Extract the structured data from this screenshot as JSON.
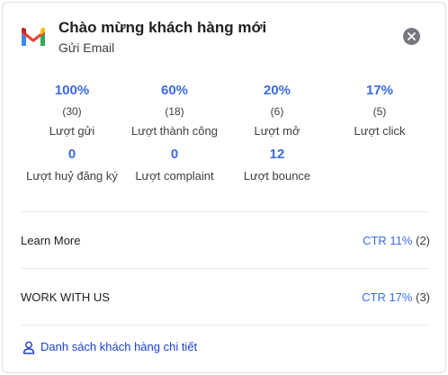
{
  "header": {
    "title": "Chào mừng khách hàng mới",
    "subtitle": "Gửi Email",
    "icon": "gmail-icon",
    "close_icon": "close-icon"
  },
  "stats": [
    {
      "percent": "100%",
      "count": "(30)",
      "label": "Lượt gửi"
    },
    {
      "percent": "60%",
      "count": "(18)",
      "label": "Lượt thành công"
    },
    {
      "percent": "20%",
      "count": "(6)",
      "label": "Lượt mở"
    },
    {
      "percent": "17%",
      "count": "(5)",
      "label": "Lượt click"
    }
  ],
  "stats2": [
    {
      "value": "0",
      "label": "Lượt huỷ đăng ký"
    },
    {
      "value": "0",
      "label": "Lượt complaint"
    },
    {
      "value": "12",
      "label": "Lượt bounce"
    }
  ],
  "links": [
    {
      "name": "Learn More",
      "ctr": "CTR 11%",
      "count": "(2)"
    },
    {
      "name": "WORK WITH US",
      "ctr": "CTR 17%",
      "count": "(3)"
    }
  ],
  "footer": {
    "label": "Danh sách khách hàng chi tiết",
    "icon": "person-icon"
  },
  "colors": {
    "accent": "#3b6be0",
    "link": "#1a3fd4",
    "text": "#202124",
    "muted": "#3c4043",
    "divider": "#e8eaed"
  }
}
